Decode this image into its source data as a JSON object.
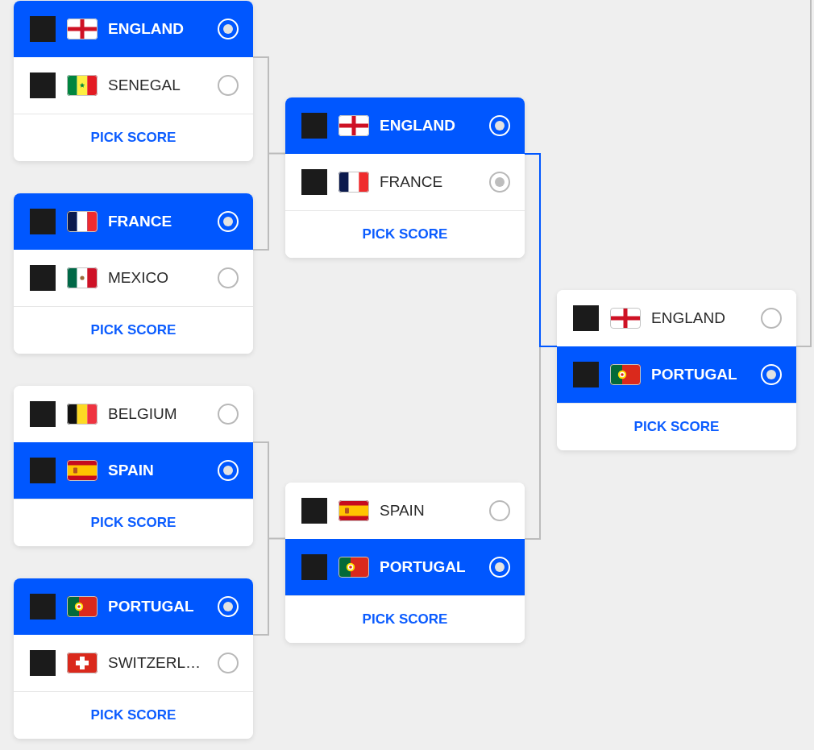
{
  "rounds": [
    {
      "matches": [
        {
          "teams": [
            {
              "name": "ENGLAND",
              "kind": "england",
              "selected": true,
              "checked": true
            },
            {
              "name": "SENEGAL",
              "kind": "senegal",
              "selected": false,
              "checked": false
            }
          ],
          "action": "PICK SCORE",
          "path_highlighted": false
        },
        {
          "teams": [
            {
              "name": "FRANCE",
              "kind": "france",
              "selected": true,
              "checked": true
            },
            {
              "name": "MEXICO",
              "kind": "mexico",
              "selected": false,
              "checked": false
            }
          ],
          "action": "PICK SCORE",
          "path_highlighted": false
        },
        {
          "teams": [
            {
              "name": "BELGIUM",
              "kind": "belgium",
              "selected": false,
              "checked": false
            },
            {
              "name": "SPAIN",
              "kind": "spain",
              "selected": true,
              "checked": true
            }
          ],
          "action": "PICK SCORE",
          "path_highlighted": false
        },
        {
          "teams": [
            {
              "name": "PORTUGAL",
              "kind": "portugal",
              "selected": true,
              "checked": true
            },
            {
              "name": "SWITZERL…",
              "kind": "switzerland",
              "selected": false,
              "checked": false
            }
          ],
          "action": "PICK SCORE",
          "path_highlighted": false
        }
      ]
    },
    {
      "matches": [
        {
          "teams": [
            {
              "name": "ENGLAND",
              "kind": "england",
              "selected": true,
              "checked": true
            },
            {
              "name": "FRANCE",
              "kind": "france",
              "selected": false,
              "checked": true
            }
          ],
          "action": "PICK SCORE",
          "path_highlighted": true
        },
        {
          "teams": [
            {
              "name": "SPAIN",
              "kind": "spain",
              "selected": false,
              "checked": false
            },
            {
              "name": "PORTUGAL",
              "kind": "portugal",
              "selected": true,
              "checked": true
            }
          ],
          "action": "PICK SCORE",
          "path_highlighted": false
        }
      ]
    },
    {
      "matches": [
        {
          "teams": [
            {
              "name": "ENGLAND",
              "kind": "england",
              "selected": false,
              "checked": false
            },
            {
              "name": "PORTUGAL",
              "kind": "portugal",
              "selected": true,
              "checked": true
            }
          ],
          "action": "PICK SCORE",
          "path_highlighted": false
        }
      ]
    }
  ]
}
